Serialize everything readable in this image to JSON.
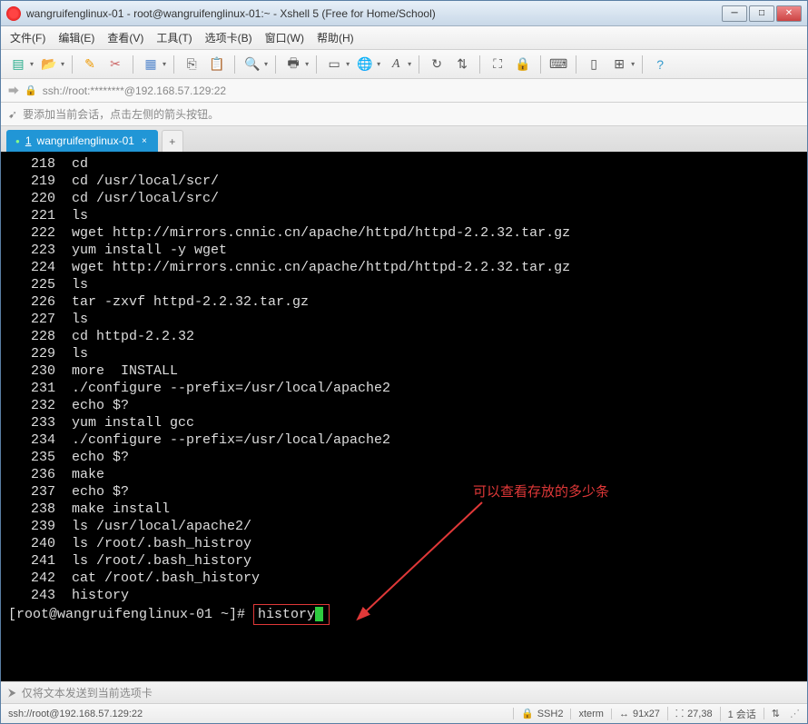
{
  "window": {
    "title": "wangruifenglinux-01 - root@wangruifenglinux-01:~ - Xshell 5 (Free for Home/School)"
  },
  "menu": {
    "file": "文件(F)",
    "edit": "编辑(E)",
    "view": "查看(V)",
    "tools": "工具(T)",
    "optiontab": "选项卡(B)",
    "window": "窗口(W)",
    "help": "帮助(H)"
  },
  "address": {
    "text": "ssh://root:********@192.168.57.129:22"
  },
  "hint": {
    "text": "要添加当前会话，点击左侧的箭头按钮。"
  },
  "tab": {
    "index": "1",
    "label": "wangruifenglinux-01",
    "add": "+"
  },
  "history": [
    {
      "n": "218",
      "c": "cd"
    },
    {
      "n": "219",
      "c": "cd /usr/local/scr/"
    },
    {
      "n": "220",
      "c": "cd /usr/local/src/"
    },
    {
      "n": "221",
      "c": "ls"
    },
    {
      "n": "222",
      "c": "wget http://mirrors.cnnic.cn/apache/httpd/httpd-2.2.32.tar.gz"
    },
    {
      "n": "223",
      "c": "yum install -y wget"
    },
    {
      "n": "224",
      "c": "wget http://mirrors.cnnic.cn/apache/httpd/httpd-2.2.32.tar.gz"
    },
    {
      "n": "225",
      "c": "ls"
    },
    {
      "n": "226",
      "c": "tar -zxvf httpd-2.2.32.tar.gz"
    },
    {
      "n": "227",
      "c": "ls"
    },
    {
      "n": "228",
      "c": "cd httpd-2.2.32"
    },
    {
      "n": "229",
      "c": "ls"
    },
    {
      "n": "230",
      "c": "more  INSTALL"
    },
    {
      "n": "231",
      "c": "./configure --prefix=/usr/local/apache2"
    },
    {
      "n": "232",
      "c": "echo $?"
    },
    {
      "n": "233",
      "c": "yum install gcc"
    },
    {
      "n": "234",
      "c": "./configure --prefix=/usr/local/apache2"
    },
    {
      "n": "235",
      "c": "echo $?"
    },
    {
      "n": "236",
      "c": "make"
    },
    {
      "n": "237",
      "c": "echo $?"
    },
    {
      "n": "238",
      "c": "make install"
    },
    {
      "n": "239",
      "c": "ls /usr/local/apache2/"
    },
    {
      "n": "240",
      "c": "ls /root/.bash_histroy"
    },
    {
      "n": "241",
      "c": "ls /root/.bash_history"
    },
    {
      "n": "242",
      "c": "cat /root/.bash_history"
    },
    {
      "n": "243",
      "c": "history"
    }
  ],
  "prompt": {
    "full": "[root@wangruifenglinux-01 ~]# ",
    "typed": "history"
  },
  "annotation": {
    "text": "可以查看存放的多少条"
  },
  "bottombar": {
    "text": "仅将文本发送到当前选项卡"
  },
  "status": {
    "conn": "ssh://root@192.168.57.129:22",
    "ssh": "SSH2",
    "term": "xterm",
    "size": "91x27",
    "pos": "27,38",
    "sess": "1 会话"
  },
  "icons": {
    "newtab": "new-tab-icon",
    "folder": "folder-open-icon"
  }
}
